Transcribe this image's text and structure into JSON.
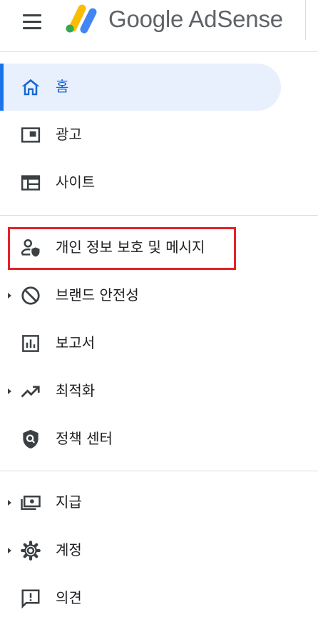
{
  "app": {
    "brand": "Google AdSense"
  },
  "nav": {
    "home": "홈",
    "ads": "광고",
    "sites": "사이트",
    "privacy": "개인 정보 보호 및 메시지",
    "brand_safety": "브랜드 안전성",
    "reports": "보고서",
    "optimization": "최적화",
    "policy_center": "정책 센터",
    "payments": "지급",
    "account": "계정",
    "feedback": "의견"
  },
  "colors": {
    "accent": "#1a73e8",
    "active_bg": "#e8f0fe",
    "highlight": "#e52128",
    "icon": "#3c4043"
  },
  "icons": {
    "home": "home-icon",
    "ads": "ad-units-icon",
    "sites": "web-icon",
    "privacy": "person-shield-icon",
    "brand_safety": "block-icon",
    "reports": "bar-chart-icon",
    "optimization": "trending-up-icon",
    "policy_center": "policy-icon",
    "payments": "payments-icon",
    "account": "gear-icon",
    "feedback": "feedback-icon"
  }
}
